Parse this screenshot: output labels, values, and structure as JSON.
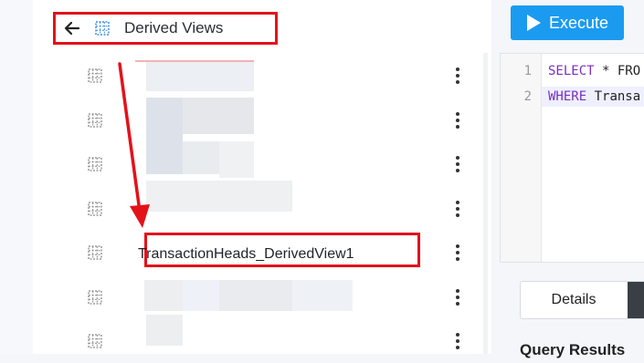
{
  "header": {
    "title": "Derived Views"
  },
  "toolbar": {
    "execute_label": "Execute"
  },
  "view_list": {
    "highlighted_item": "TransactionHeads_DerivedView1",
    "partial_item": "...xxx...",
    "row_count": 7
  },
  "editor": {
    "lines": [
      {
        "number": "1",
        "keyword": "SELECT",
        "rest": " * FRO"
      },
      {
        "number": "2",
        "keyword": "WHERE",
        "rest": " Transa"
      }
    ]
  },
  "results": {
    "tab_details": "Details",
    "section_title": "Query Results"
  },
  "colors": {
    "accent": "#1a9bf0",
    "annotation": "#e3121a"
  }
}
